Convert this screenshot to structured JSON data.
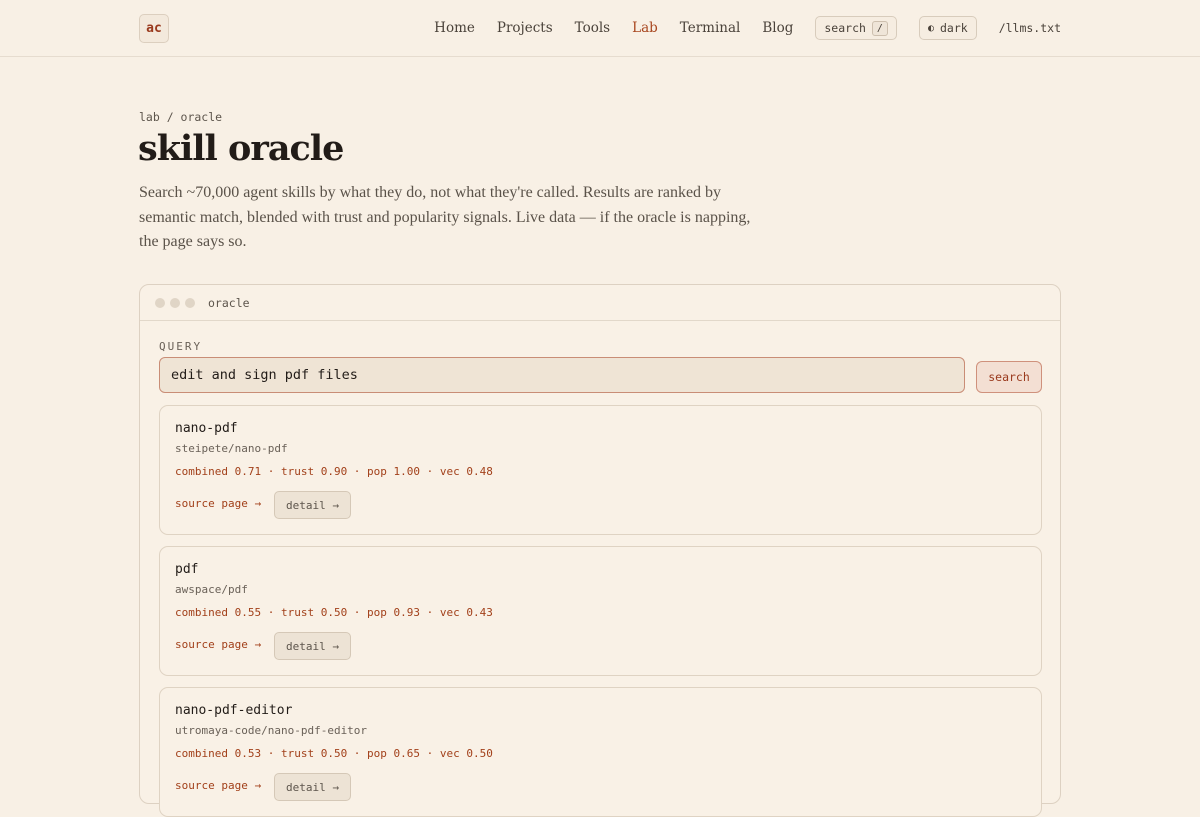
{
  "header": {
    "logo": "ac",
    "nav": [
      "Home",
      "Projects",
      "Tools",
      "Lab",
      "Terminal",
      "Blog"
    ],
    "active_nav": "Lab",
    "search_label": "search",
    "search_key": "/",
    "theme_icon": "◐",
    "theme_label": "dark",
    "llms_link": "/llms.txt"
  },
  "page": {
    "breadcrumb": "lab / oracle",
    "title": "skill oracle",
    "intro": "Search ~70,000 agent skills by what they do, not what they're called. Results are ranked by semantic match, blended with trust and popularity signals. Live data — if the oracle is napping, the page says so."
  },
  "panel": {
    "title": "oracle",
    "query_label": "QUERY",
    "query_value": "edit and sign pdf files",
    "search_button": "search"
  },
  "results": [
    {
      "name": "nano-pdf",
      "path": "steipete/nano-pdf",
      "stats": "combined 0.71 · trust 0.90 · pop 1.00 · vec 0.48",
      "source_link": "source page →",
      "detail_button": "detail →"
    },
    {
      "name": "pdf",
      "path": "awspace/pdf",
      "stats": "combined 0.55 · trust 0.50 · pop 0.93 · vec 0.43",
      "source_link": "source page →",
      "detail_button": "detail →"
    },
    {
      "name": "nano-pdf-editor",
      "path": "utromaya-code/nano-pdf-editor",
      "stats": "combined 0.53 · trust 0.50 · pop 0.65 · vec 0.50",
      "source_link": "source page →",
      "detail_button": "detail →"
    }
  ]
}
